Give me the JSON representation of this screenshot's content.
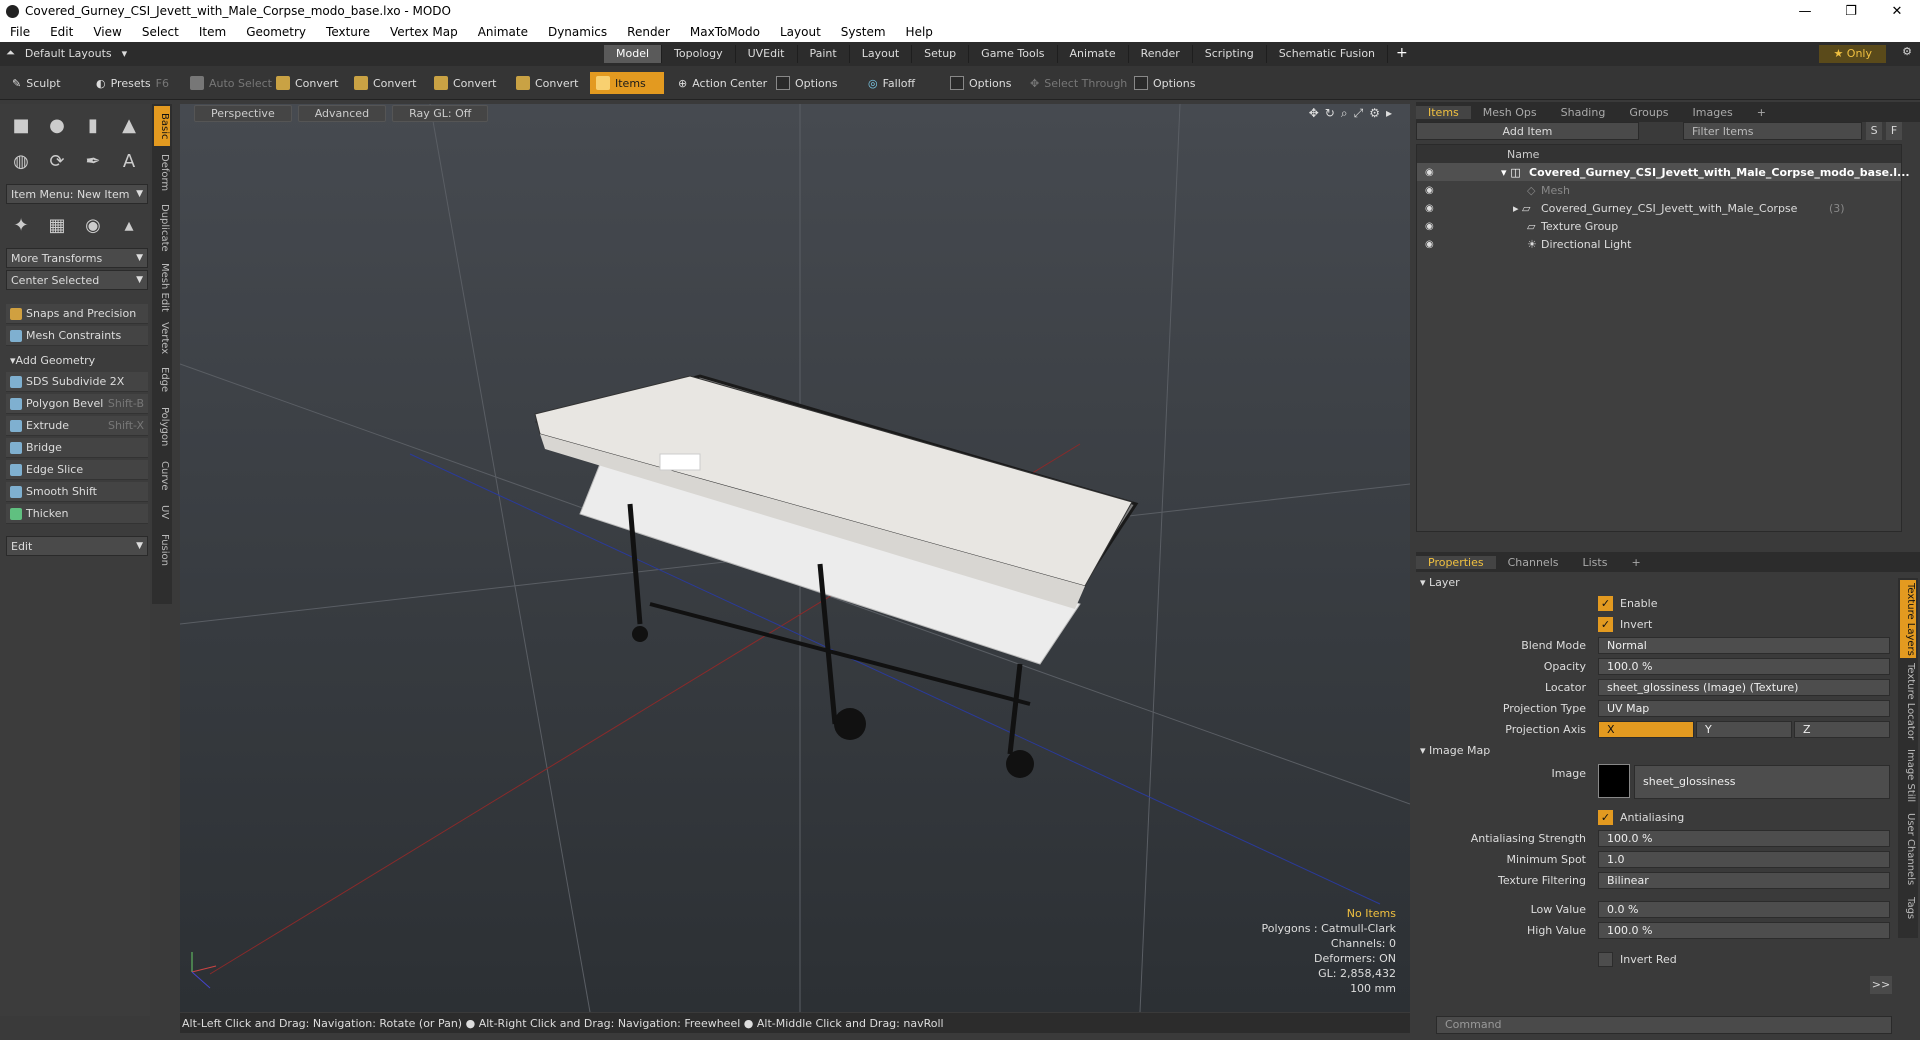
{
  "window": {
    "title": "Covered_Gurney_CSI_Jevett_with_Male_Corpse_modo_base.lxo - MODO",
    "min": "—",
    "max": "❐",
    "close": "✕"
  },
  "menu": [
    "File",
    "Edit",
    "View",
    "Select",
    "Item",
    "Geometry",
    "Texture",
    "Vertex Map",
    "Animate",
    "Dynamics",
    "Render",
    "MaxToModo",
    "Layout",
    "System",
    "Help"
  ],
  "modebar": {
    "layouts": "Default Layouts",
    "tabs": [
      "Model",
      "Topology",
      "UVEdit",
      "Paint",
      "Layout",
      "Setup",
      "Game Tools",
      "Animate",
      "Render",
      "Scripting",
      "Schematic Fusion"
    ],
    "only": "Only"
  },
  "toolbar": {
    "sculpt": "Sculpt",
    "presets": "Presets",
    "presets_key": "F6",
    "auto_select": "Auto Select",
    "convert": "Convert",
    "items": "Items",
    "action_center": "Action Center",
    "options": "Options",
    "falloff": "Falloff",
    "select_through": "Select Through"
  },
  "left": {
    "vtabs": [
      "Basic",
      "Deform",
      "Duplicate",
      "Mesh Edit",
      "Vertex",
      "Edge",
      "Polygon",
      "Curve",
      "UV",
      "Fusion"
    ],
    "item_menu": "Item Menu: New Item",
    "more_transforms": "More Transforms",
    "center_selected": "Center Selected",
    "snaps": "Snaps and Precision",
    "constraints": "Mesh Constraints",
    "add_geometry": "Add Geometry",
    "tools": [
      {
        "label": "SDS Subdivide 2X",
        "key": ""
      },
      {
        "label": "Polygon Bevel",
        "key": "Shift-B"
      },
      {
        "label": "Extrude",
        "key": "Shift-X"
      },
      {
        "label": "Bridge",
        "key": ""
      },
      {
        "label": "Edge Slice",
        "key": ""
      },
      {
        "label": "Smooth Shift",
        "key": ""
      },
      {
        "label": "Thicken",
        "key": ""
      }
    ],
    "edit": "Edit"
  },
  "viewport": {
    "view": "Perspective",
    "shading": "Advanced",
    "raygl": "Ray GL: Off",
    "stats": {
      "items": "No Items",
      "polygons": "Polygons : Catmull-Clark",
      "channels": "Channels: 0",
      "deformers": "Deformers: ON",
      "gl": "GL: 2,858,432",
      "scale": "100 mm"
    }
  },
  "status": "Alt-Left Click and Drag: Navigation: Rotate (or Pan) ● Alt-Right Click and Drag: Navigation: Freewheel ● Alt-Middle Click and Drag: navRoll",
  "items_panel": {
    "tabs": [
      "Items",
      "Mesh Ops",
      "Shading",
      "Groups",
      "Images"
    ],
    "add_item": "Add Item",
    "filter": "Filter Items",
    "s": "S",
    "f": "F",
    "name_col": "Name",
    "rows": [
      "Covered_Gurney_CSI_Jevett_with_Male_Corpse_modo_base.l...",
      "Mesh",
      "Covered_Gurney_CSI_Jevett_with_Male_Corpse",
      "Texture Group",
      "Directional Light"
    ],
    "count": "(3)"
  },
  "props": {
    "tabs": [
      "Properties",
      "Channels",
      "Lists"
    ],
    "layer": "Layer",
    "enable": "Enable",
    "invert": "Invert",
    "blend_mode_l": "Blend Mode",
    "blend_mode": "Normal",
    "opacity_l": "Opacity",
    "opacity": "100.0 %",
    "locator_l": "Locator",
    "locator": "sheet_glossiness (Image) (Texture)",
    "proj_type_l": "Projection Type",
    "proj_type": "UV Map",
    "proj_axis_l": "Projection Axis",
    "axis_x": "X",
    "axis_y": "Y",
    "axis_z": "Z",
    "image_map": "Image Map",
    "image_l": "Image",
    "image": "sheet_glossiness",
    "antialiasing": "Antialiasing",
    "aa_strength_l": "Antialiasing Strength",
    "aa_strength": "100.0 %",
    "min_spot_l": "Minimum Spot",
    "min_spot": "1.0",
    "filtering_l": "Texture Filtering",
    "filtering": "Bilinear",
    "low_l": "Low Value",
    "low": "0.0 %",
    "high_l": "High Value",
    "high": "100.0 %",
    "invert_red": "Invert Red",
    "more": ">>",
    "command": "Command",
    "rvtabs": [
      "Texture Layers",
      "Texture Locator",
      "Image Still",
      "User Channels",
      "Tags"
    ]
  },
  "colors": {
    "accent": "#e39a20",
    "selected_text": "#f0c040"
  }
}
